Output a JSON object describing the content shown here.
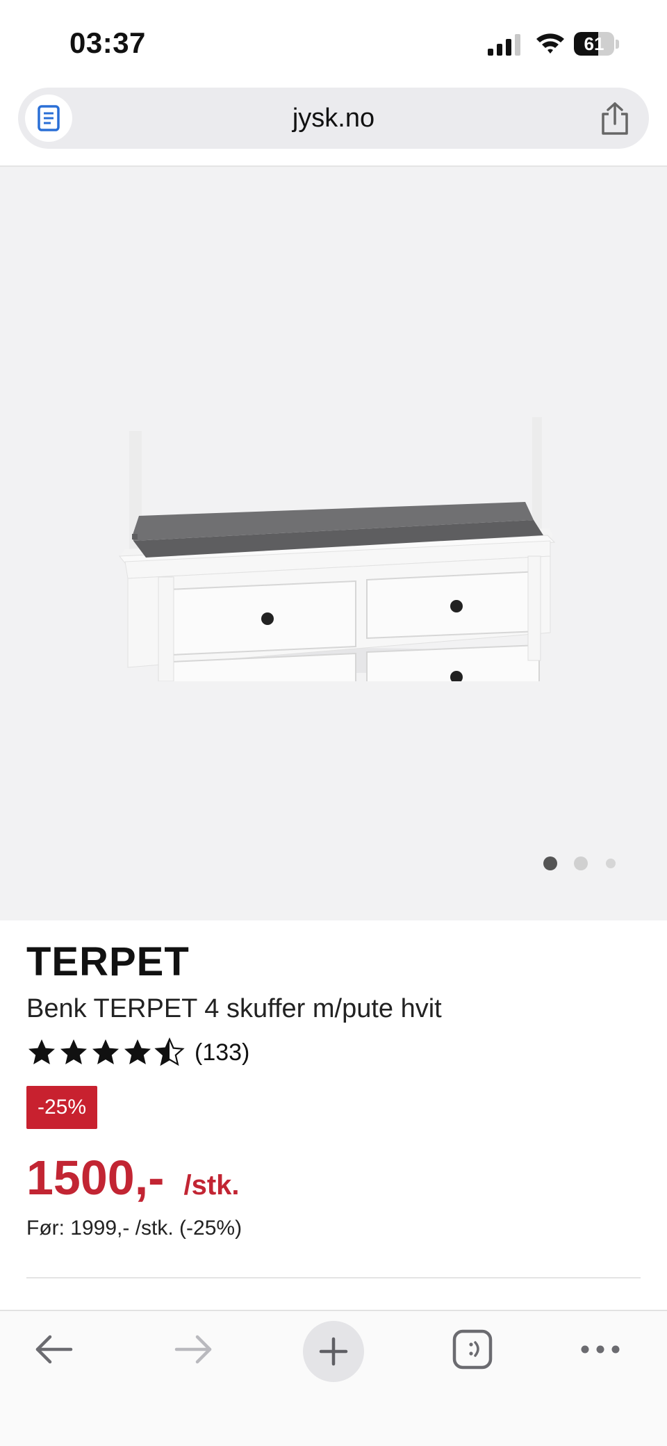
{
  "status_bar": {
    "time": "03:37",
    "battery_percent": "61",
    "battery_level": 0.61
  },
  "address_bar": {
    "url": "jysk.no",
    "reader_icon": "reader-icon",
    "share_icon": "share-icon"
  },
  "gallery": {
    "image": "bench-drawers-cushion-image",
    "pages": 3,
    "active_page": 1
  },
  "product": {
    "brand": "TERPET",
    "name": "Benk TERPET 4 skuffer m/pute hvit",
    "rating": 4.5,
    "review_count": "(133)",
    "discount_badge": "-25%",
    "price": "1500,-",
    "unit": "/stk.",
    "old_price": "Før: 1999,- /stk. (-25%)"
  },
  "toolbar": {
    "back_icon": "back-arrow-icon",
    "forward_icon": "forward-arrow-icon",
    "new_tab_icon": "plus-icon",
    "tabs_icon": "tabs-icon",
    "menu_icon": "more-icon"
  },
  "colors": {
    "price_red": "#c22533",
    "badge_red": "#c8212f",
    "hero_bg": "#f2f2f3",
    "address_bg": "#ebebee"
  }
}
